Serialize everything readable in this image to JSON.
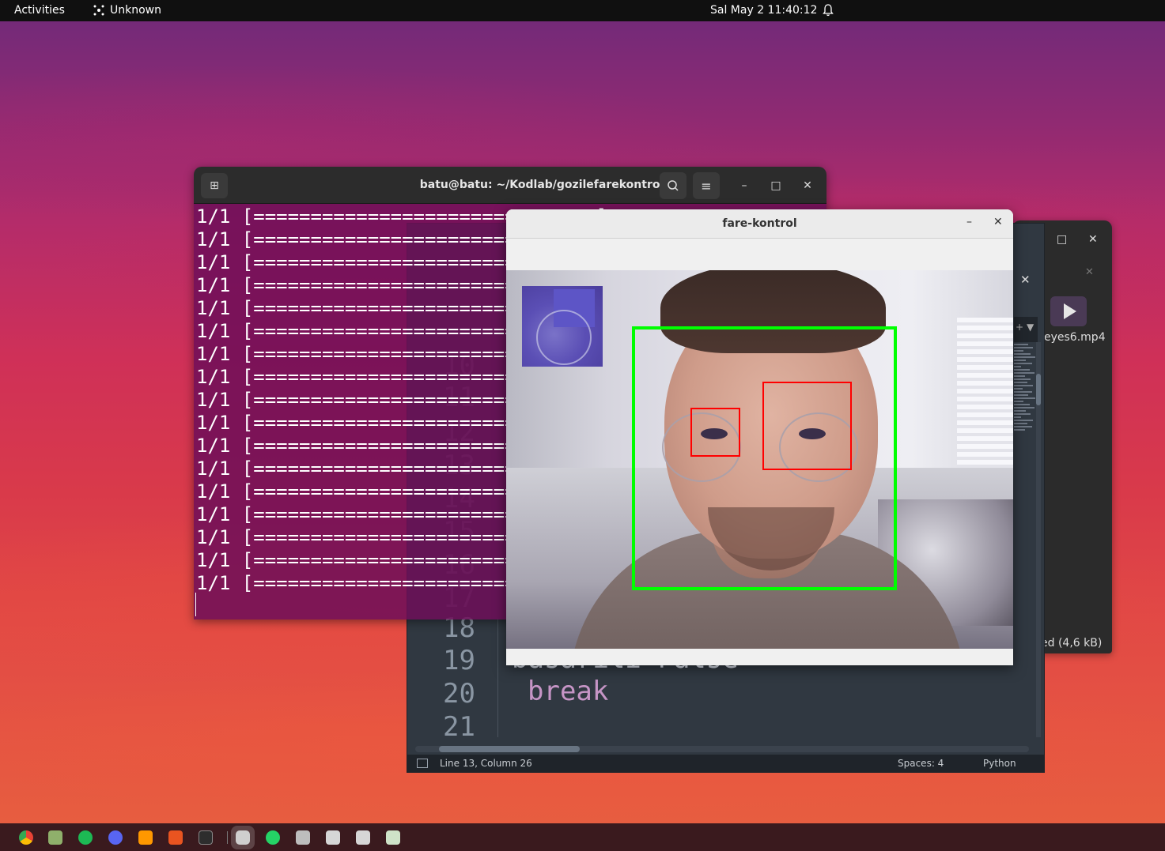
{
  "topbar": {
    "activities": "Activities",
    "app_name": "Unknown",
    "clock": "Sal May 2  11:40:12"
  },
  "back_window": {
    "file_name": "eyes6.mp4",
    "status": "ed (4,6 kB)"
  },
  "editor": {
    "line_numbers_faint": [
      "10",
      "11",
      "12",
      "13",
      "14",
      "15",
      "16",
      "17"
    ],
    "line_numbers": [
      "18",
      "19",
      "20",
      "21"
    ],
    "code_partial": "basarili  False",
    "code_break": "break",
    "status_position": "Line 13, Column 26",
    "status_spaces": "Spaces: 4",
    "status_language": "Python"
  },
  "terminal": {
    "title": "batu@batu: ~/Kodlab/gozilefarekontrol",
    "lines": [
      "1/1 [==============================]",
      "1/1 [==============================]",
      "1/1 [==============================]",
      "1/1 [==============================]",
      "1/1 [==============================]",
      "1/1 [==============================]",
      "1/1 [==============================]",
      "1/1 [==============================]",
      "1/1 [==============================]",
      "1/1 [==============================]",
      "1/1 [==============================]",
      "1/1 [==============================]",
      "1/1 [==============================]",
      "1/1 [==============================]",
      "1/1 [==============================]",
      "1/1 [==============================]",
      "1/1 [==============================]"
    ]
  },
  "fare_window": {
    "title": "fare-kontrol"
  },
  "dock": {
    "apps": [
      "chrome",
      "files",
      "spotify",
      "discord",
      "sublime-text",
      "software",
      "terminal",
      "screenshot",
      "whatsapp",
      "document",
      "document",
      "document",
      "trash"
    ]
  },
  "colors": {
    "face_box": "#00ff00",
    "eye_box": "#ff0000",
    "terminal_bg": "#6e0e58"
  }
}
